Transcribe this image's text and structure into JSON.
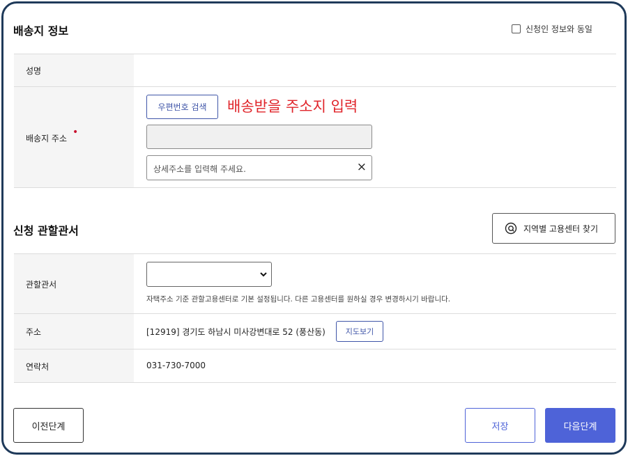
{
  "shipping": {
    "title": "배송지 정보",
    "same_as_applicant_label": "신청인 정보와 동일",
    "same_as_applicant_checked": false,
    "name_label": "성명",
    "name_value": "",
    "address_label": "배송지 주소",
    "required_mark": "•",
    "postcode_button": "우편번호 검색",
    "annotation": "배송받을 주소지 입력",
    "address_value": "",
    "detail_placeholder": "상세주소를 입력해 주세요.",
    "clear_glyph": "×"
  },
  "office": {
    "title": "신청 관할관서",
    "find_button": "지역별 고용센터 찾기",
    "office_label": "관할관서",
    "office_selected": "",
    "office_note": "자택주소 기준 관할고용센터로 기본 설정됩니다. 다른 고용센터를 원하실 경우 변경하시기 바랍니다.",
    "address_label": "주소",
    "address_value": "[12919] 경기도 하남시 미사강변대로 52 (풍산동)",
    "map_button": "지도보기",
    "phone_label": "연락처",
    "phone_value": "031-730-7000"
  },
  "footer": {
    "prev_button": "이전단계",
    "save_button": "저장",
    "next_button": "다음단계"
  },
  "colors": {
    "accent": "#4e63d8",
    "annotation": "#e0242a",
    "required": "#c8102e",
    "frame": "#1f3a5a"
  }
}
